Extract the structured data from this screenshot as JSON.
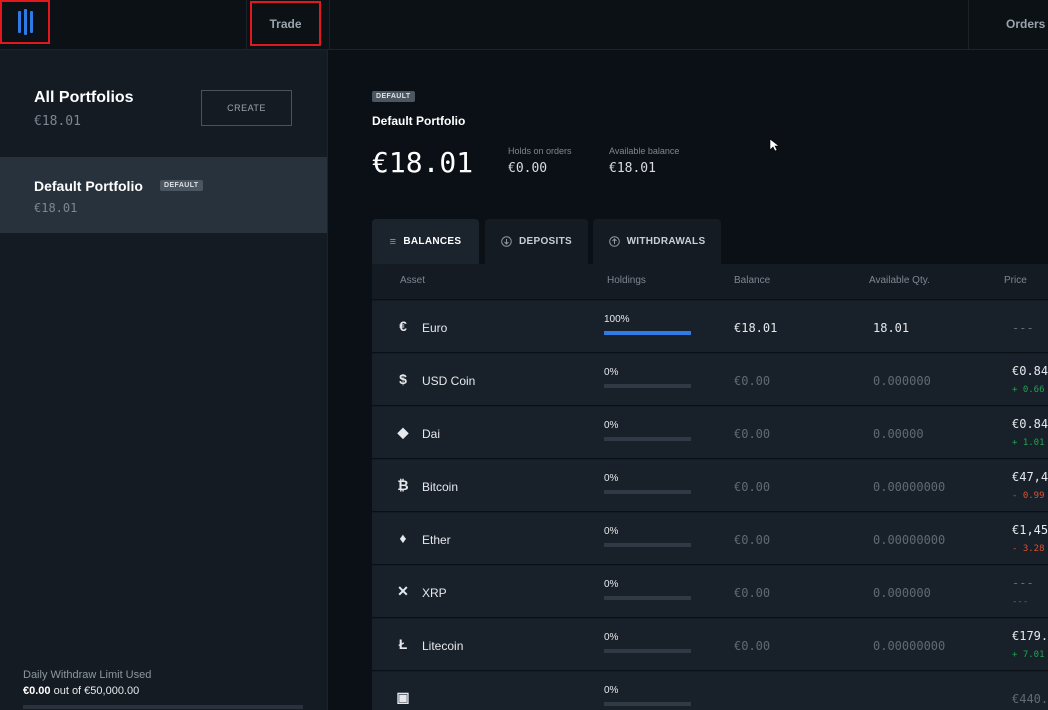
{
  "topbar": {
    "trade_label": "Trade",
    "orders_label": "Orders",
    "accent": "#2f7ae5"
  },
  "sidebar": {
    "all_portfolios_title": "All Portfolios",
    "all_portfolios_amount": "€18.01",
    "create_label": "CREATE",
    "selected_portfolio": {
      "name": "Default Portfolio",
      "badge": "DEFAULT",
      "amount": "€18.01"
    },
    "withdraw_limit": {
      "label": "Daily Withdraw Limit Used",
      "used": "€0.00",
      "out_of": "out of €50,000.00"
    }
  },
  "portfolio": {
    "badge": "DEFAULT",
    "name": "Default Portfolio",
    "total": "€18.01",
    "holds_label": "Holds on orders",
    "holds_value": "€0.00",
    "available_label": "Available balance",
    "available_value": "€18.01"
  },
  "tabs": [
    {
      "label": "BALANCES",
      "icon": "list-icon"
    },
    {
      "label": "DEPOSITS",
      "icon": "arrow-down-circle-icon"
    },
    {
      "label": "WITHDRAWALS",
      "icon": "arrow-up-circle-icon"
    }
  ],
  "table": {
    "headers": {
      "asset": "Asset",
      "holdings": "Holdings",
      "balance": "Balance",
      "available": "Available Qty.",
      "price": "Price"
    },
    "rows": [
      {
        "icon": "euro-icon",
        "glyph": "€",
        "name": "Euro",
        "holding_pct": "100%",
        "holding_frac": 1.0,
        "balance": "€18.01",
        "available": "18.01",
        "price": "---",
        "change": "",
        "change_dir": "none"
      },
      {
        "icon": "usdc-icon",
        "glyph": "$",
        "name": "USD Coin",
        "holding_pct": "0%",
        "holding_frac": 0,
        "balance": "€0.00",
        "available": "0.000000",
        "price": "€0.84",
        "change": "+ 0.66",
        "change_dir": "up"
      },
      {
        "icon": "dai-icon",
        "glyph": "◆",
        "name": "Dai",
        "holding_pct": "0%",
        "holding_frac": 0,
        "balance": "€0.00",
        "available": "0.00000",
        "price": "€0.84",
        "change": "+ 1.01",
        "change_dir": "up"
      },
      {
        "icon": "bitcoin-icon",
        "glyph": "₿",
        "name": "Bitcoin",
        "holding_pct": "0%",
        "holding_frac": 0,
        "balance": "€0.00",
        "available": "0.00000000",
        "price": "€47,4",
        "change": "- 0.99",
        "change_dir": "down"
      },
      {
        "icon": "ether-icon",
        "glyph": "♦",
        "name": "Ether",
        "holding_pct": "0%",
        "holding_frac": 0,
        "balance": "€0.00",
        "available": "0.00000000",
        "price": "€1,45",
        "change": "- 3.28",
        "change_dir": "down"
      },
      {
        "icon": "xrp-icon",
        "glyph": "✕",
        "name": "XRP",
        "holding_pct": "0%",
        "holding_frac": 0,
        "balance": "€0.00",
        "available": "0.000000",
        "price": "---",
        "change": "---",
        "change_dir": "none"
      },
      {
        "icon": "litecoin-icon",
        "glyph": "Ł",
        "name": "Litecoin",
        "holding_pct": "0%",
        "holding_frac": 0,
        "balance": "€0.00",
        "available": "0.00000000",
        "price": "€179.",
        "change": "+ 7.01",
        "change_dir": "up"
      },
      {
        "icon": "asset-icon",
        "glyph": "▣",
        "name": "",
        "holding_pct": "0%",
        "holding_frac": 0,
        "balance": "",
        "available": "",
        "price": "€440.",
        "change": "",
        "change_dir": "none"
      }
    ]
  }
}
